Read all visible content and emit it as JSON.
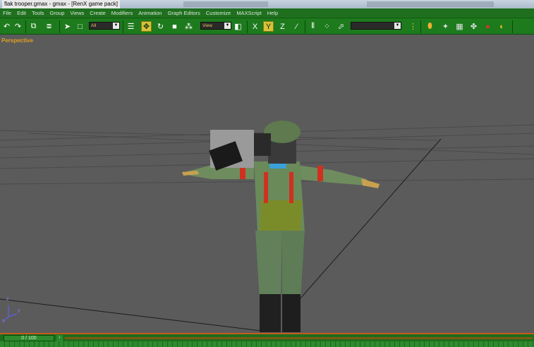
{
  "window": {
    "title": "flak trooper.gmax - gmax - [RenX game pack]"
  },
  "menu": {
    "items": [
      "File",
      "Edit",
      "Tools",
      "Group",
      "Views",
      "Create",
      "Modifiers",
      "Animation",
      "Graph Editors",
      "Customize",
      "MAXScript",
      "Help"
    ]
  },
  "toolbar": {
    "selection_filter": "All",
    "reference_coord": "View",
    "named_selection": "",
    "icons": [
      "undo-icon",
      "redo-icon",
      "link-icon",
      "unlink-icon",
      "select-icon",
      "region-select-icon",
      "select-by-name-icon",
      "move-icon",
      "rotate-icon",
      "scale-icon",
      "snap-icon",
      "mirror-icon",
      "axis-x-icon",
      "axis-y-icon",
      "axis-z-icon",
      "align-icon",
      "render-icon",
      "material-icon"
    ]
  },
  "viewport": {
    "label": "Perspective",
    "axis": {
      "x": "x",
      "y": "y",
      "z": "z"
    }
  },
  "timeslider": {
    "value": "0 / 100",
    "current_frame": 0,
    "total_frames": 100
  },
  "colors": {
    "toolbar_bg": "#1d7a1d",
    "menu_bg": "#1f6f1f",
    "viewport_bg": "#5b5b5b",
    "viewport_label": "#e0a020",
    "active_tool": "#d8c23a"
  }
}
